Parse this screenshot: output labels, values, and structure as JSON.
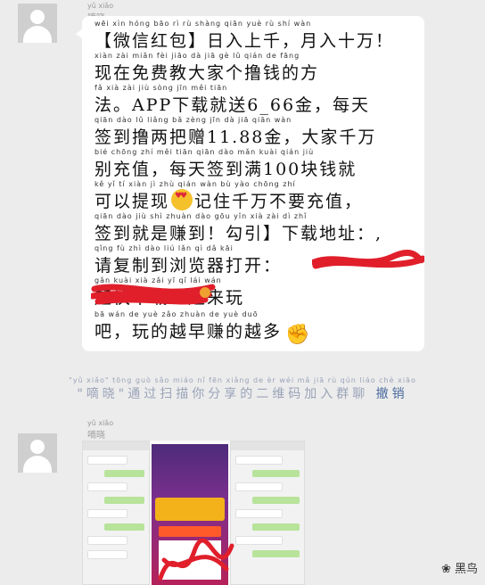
{
  "messages": [
    {
      "sender": {
        "name": "嘀晓",
        "pinyin": "yǔ xiǎo"
      },
      "lines": [
        {
          "py": "wēi xìn hóng bāo    rì rù shàng qiān  yuè rù shí wàn",
          "text": "【微信红包】日入上千，月入十万！"
        },
        {
          "py": "xiàn zài miǎn fèi jiāo dà jiā gè lǔ qián de fāng",
          "text": "现在免费教大家个撸钱的方"
        },
        {
          "py": "fǎ      xià zài jiù sòng         jīn    měi tiān",
          "text": "法。APP下载就送6_66金，每天"
        },
        {
          "py": "qiān dào lǔ liǎng bǎ zèng      jīn   dà jiā qiān wàn",
          "text": "签到撸两把赠11.88金，大家千万"
        },
        {
          "py": "bié chōng zhí   měi tiān qiān dào mǎn    kuài qián jiù",
          "text": "别充值，每天签到满100块钱就"
        },
        {
          "py": "kě yǐ tí xiàn    jì zhù qián wàn bù yào chōng zhí",
          "text": "可以提现",
          "emoji": true,
          "text2": "记住千万不要充值，"
        },
        {
          "py": "qiān dào jiù shì zhuàn dào   gōu yǐn  xià zài dì zhǐ",
          "text": "签到就是赚到！勾引】下载地址：,"
        },
        {
          "py": "qǐng fù zhì dào liú lǎn qì dǎ kāi",
          "text": "请复制到浏览器打开："
        },
        {
          "py": "                gǎn kuài xià zǎi yī qǐ lái wán",
          "text": "                赶快下载一起来玩"
        },
        {
          "py": "bā    wán de yuè zǎo zhuàn de yuè duō",
          "text": "吧，玩的越早赚的越多",
          "fist": true
        }
      ]
    }
  ],
  "system": {
    "pinyin": "\"yǔ xiǎo\" tōng guò sǎo miáo nǐ fēn xiǎng de èr wéi mǎ jiā rù qún liáo    chè xiāo",
    "text": "\"嘀晓\"通过扫描你分享的二维码加入群聊",
    "link": "撤销"
  },
  "second_sender": {
    "name": "嘀晓",
    "pinyin": "yǔ xiǎo"
  },
  "watermark": "黑鸟",
  "icons": {
    "fist": "✊",
    "wechat": "wechat-bird-icon"
  }
}
